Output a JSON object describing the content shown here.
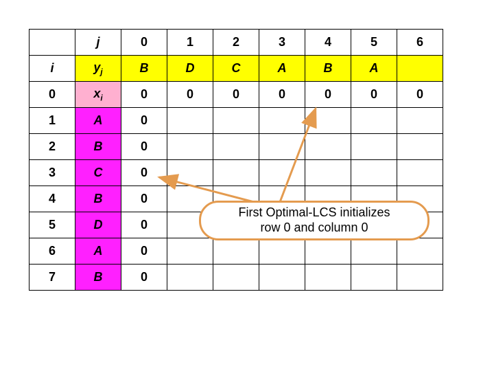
{
  "header": {
    "j_label": "j",
    "i_label": "i",
    "yj_label_main": "y",
    "yj_label_sub": "j",
    "xi_label_main": "x",
    "xi_label_sub": "i",
    "j_vals": [
      "0",
      "1",
      "2",
      "3",
      "4",
      "5",
      "6"
    ],
    "y_seq": [
      "B",
      "D",
      "C",
      "A",
      "B",
      "A"
    ]
  },
  "rows": [
    {
      "i": "0",
      "x": "",
      "cells": [
        "0",
        "0",
        "0",
        "0",
        "0",
        "0",
        "0"
      ]
    },
    {
      "i": "1",
      "x": "A",
      "cells": [
        "0",
        "",
        "",
        "",
        "",
        "",
        ""
      ]
    },
    {
      "i": "2",
      "x": "B",
      "cells": [
        "0",
        "",
        "",
        "",
        "",
        "",
        ""
      ]
    },
    {
      "i": "3",
      "x": "C",
      "cells": [
        "0",
        "",
        "",
        "",
        "",
        "",
        ""
      ]
    },
    {
      "i": "4",
      "x": "B",
      "cells": [
        "0",
        "",
        "",
        "",
        "",
        "",
        ""
      ]
    },
    {
      "i": "5",
      "x": "D",
      "cells": [
        "0",
        "",
        "",
        "",
        "",
        "",
        ""
      ]
    },
    {
      "i": "6",
      "x": "A",
      "cells": [
        "0",
        "",
        "",
        "",
        "",
        "",
        ""
      ]
    },
    {
      "i": "7",
      "x": "B",
      "cells": [
        "0",
        "",
        "",
        "",
        "",
        "",
        ""
      ]
    }
  ],
  "callout": {
    "line1": "First Optimal-LCS initializes",
    "line2": "row 0 and column 0"
  },
  "chart_data": {
    "type": "table",
    "title": "LCS dynamic-programming table initialization",
    "x_sequence": [
      "A",
      "B",
      "C",
      "B",
      "D",
      "A",
      "B"
    ],
    "y_sequence": [
      "B",
      "D",
      "C",
      "A",
      "B",
      "A"
    ],
    "initialized_row0": [
      0,
      0,
      0,
      0,
      0,
      0,
      0
    ],
    "initialized_col0": [
      0,
      0,
      0,
      0,
      0,
      0,
      0,
      0
    ],
    "annotation": "First Optimal-LCS initializes row 0 and column 0"
  }
}
